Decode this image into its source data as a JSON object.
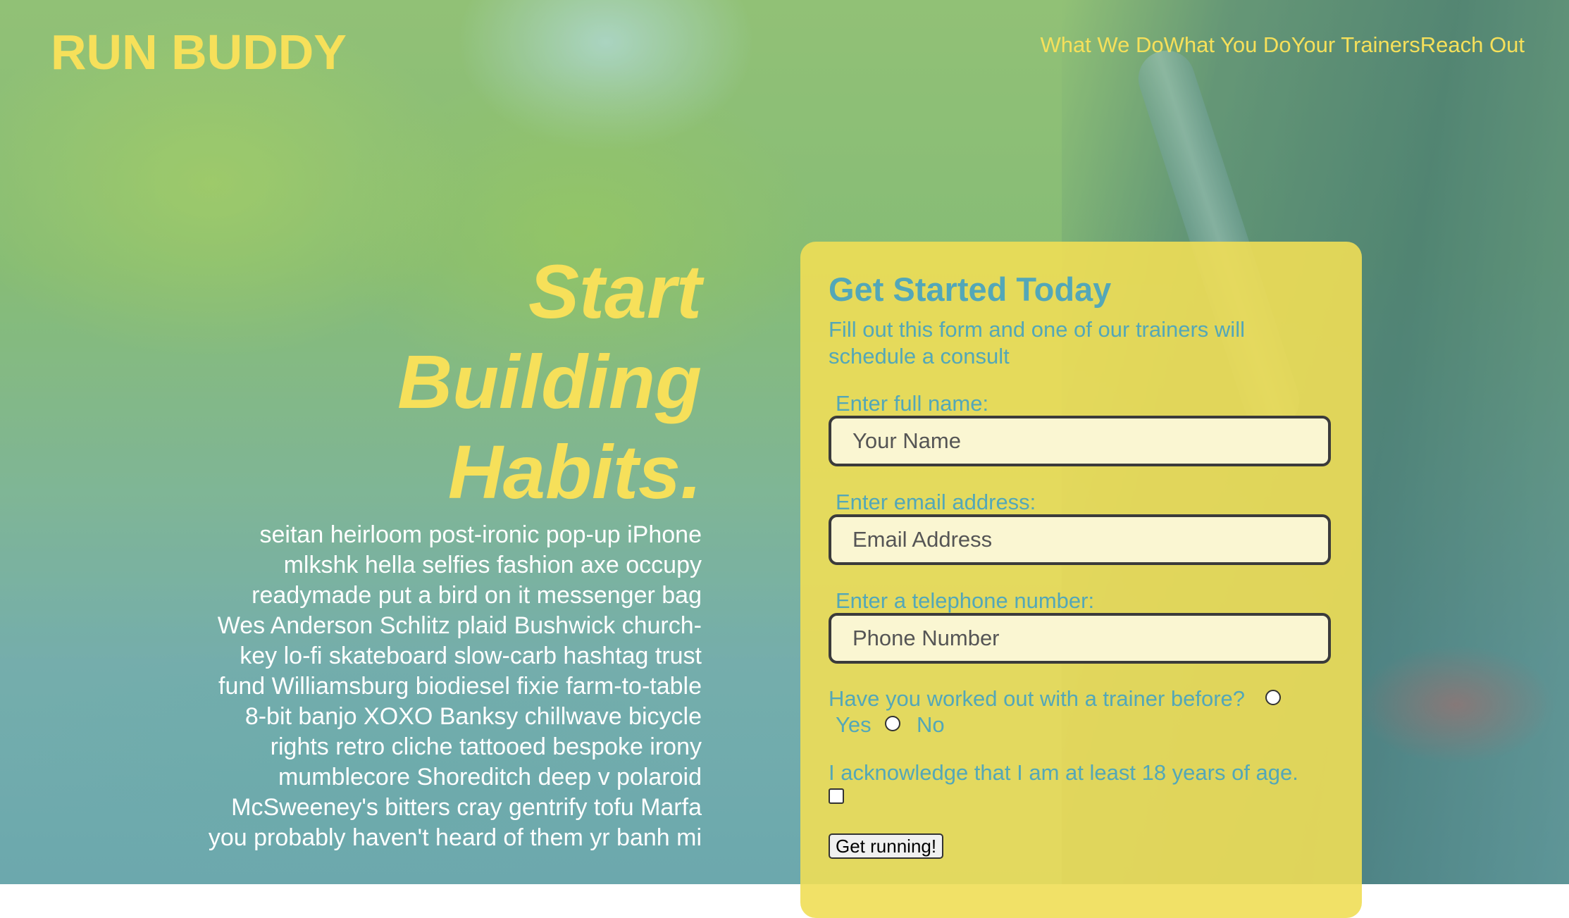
{
  "brand": {
    "logo": "RUN BUDDY",
    "accent_color": "#f6e05a",
    "text_color": "#53a7b8"
  },
  "nav": {
    "items": [
      "What We Do",
      "What You Do",
      "Your Trainers",
      "Reach Out"
    ]
  },
  "hero": {
    "heading_lines": [
      "Start",
      "Building",
      "Habits."
    ],
    "body": "seitan heirloom post-ironic pop-up iPhone mlkshk hella selfies fashion axe occupy readymade put a bird on it messenger bag Wes Anderson Schlitz plaid Bushwick church-key lo-fi skateboard slow-carb hashtag trust fund Williamsburg biodiesel fixie farm-to-table 8-bit banjo XOXO Banksy chillwave bicycle rights retro cliche tattooed bespoke irony mumblecore Shoreditch deep v polaroid McSweeney's bitters cray gentrify tofu Marfa you probably haven't heard of them yr banh mi"
  },
  "form": {
    "title": "Get Started Today",
    "subtitle": "Fill out this form and one of our trainers will schedule a consult",
    "name_label": "Enter full name:",
    "name_placeholder": "Your Name",
    "email_label": "Enter email address:",
    "email_placeholder": "Email Address",
    "phone_label": "Enter a telephone number:",
    "phone_placeholder": "Phone Number",
    "trainer_question": "Have you worked out with a trainer before?",
    "yes_label": "Yes",
    "no_label": "No",
    "age_ack": "I acknowledge that I am at least 18 years of age.",
    "submit_label": "Get running!"
  }
}
